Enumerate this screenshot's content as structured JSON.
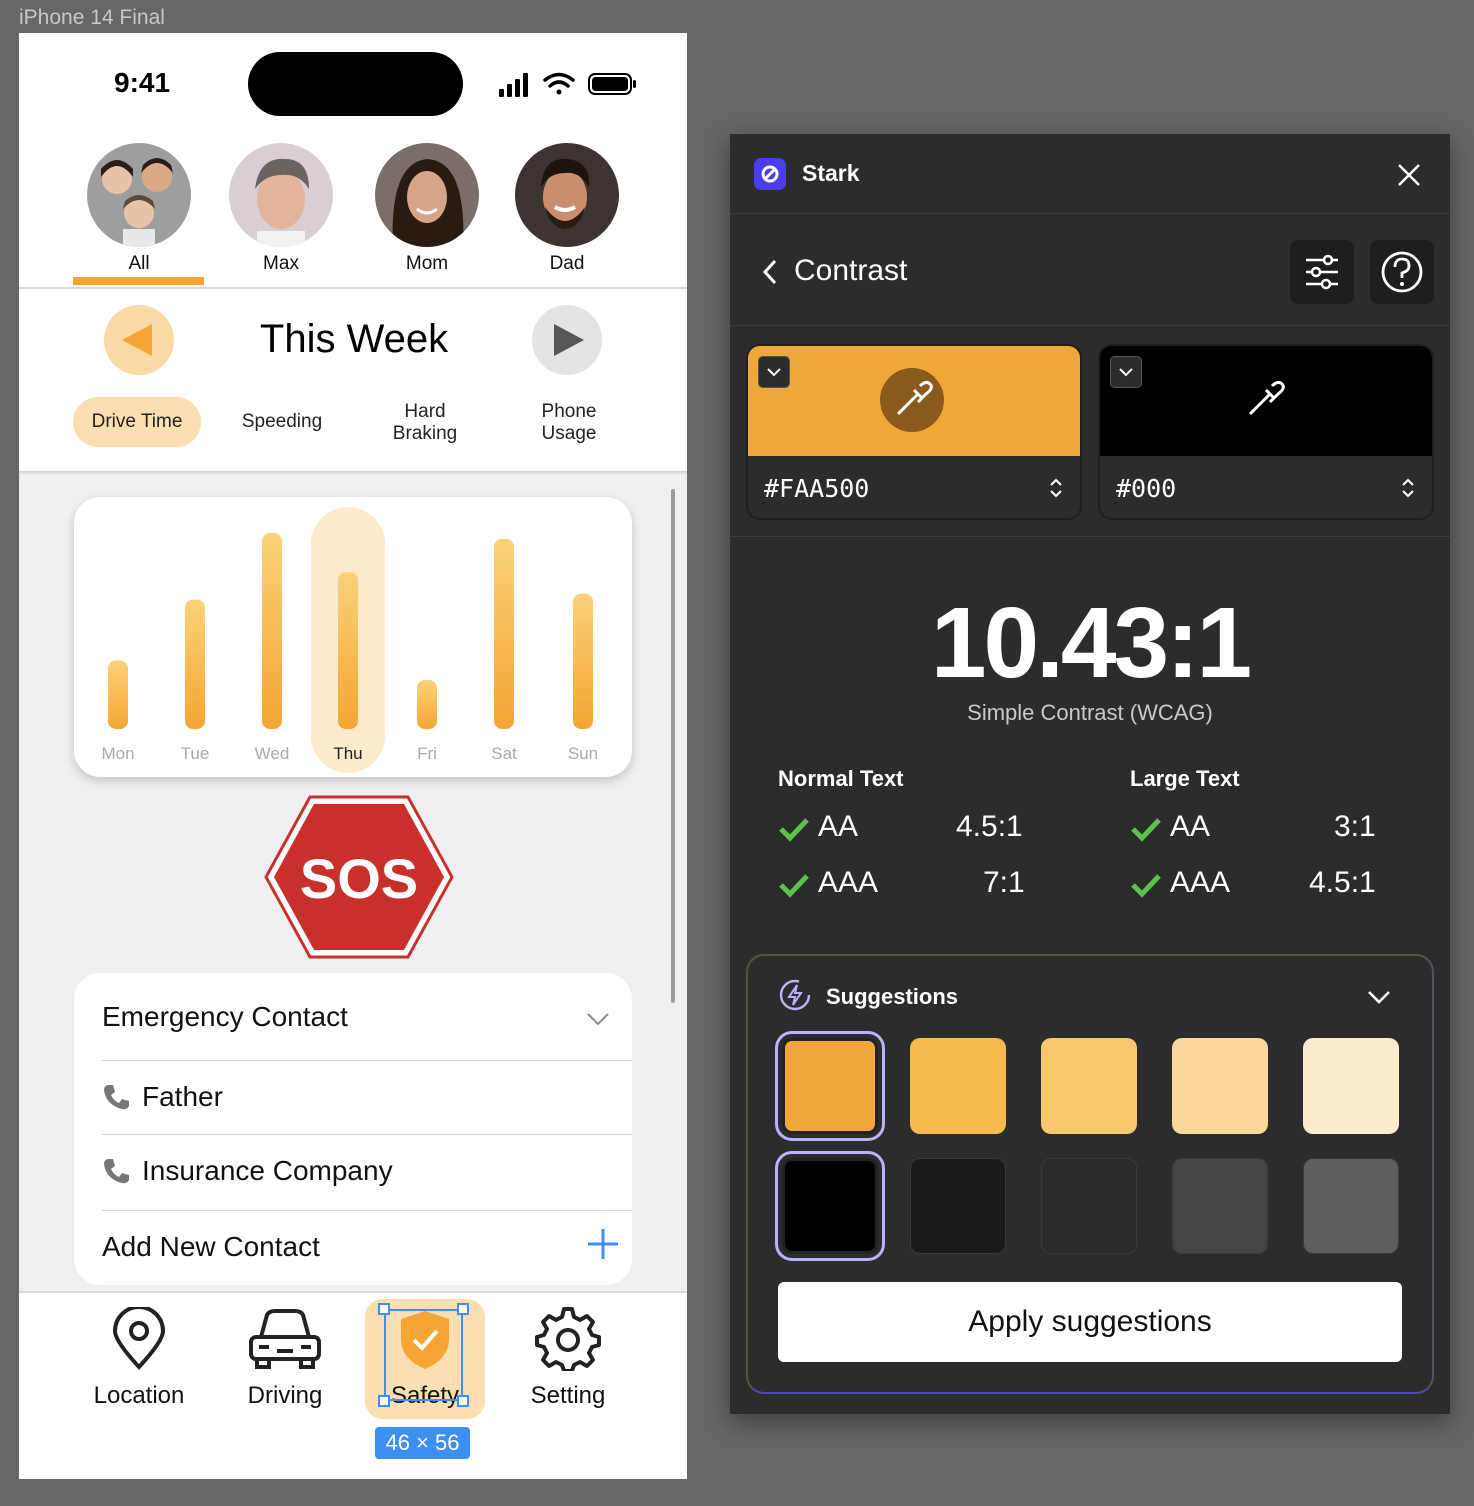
{
  "frame_label": "iPhone 14 Final",
  "phone": {
    "status_time": "9:41",
    "avatars": [
      {
        "label": "All",
        "selected": true
      },
      {
        "label": "Max",
        "selected": false
      },
      {
        "label": "Mom",
        "selected": false
      },
      {
        "label": "Dad",
        "selected": false
      }
    ],
    "week_title": "This Week",
    "metric_tabs": [
      {
        "label": "Drive Time",
        "active": true
      },
      {
        "label": "Speeding",
        "active": false
      },
      {
        "label": "Hard\nBraking",
        "active": false
      },
      {
        "label": "Phone\nUsage",
        "active": false
      }
    ],
    "chart_data": {
      "type": "bar",
      "categories": [
        "Mon",
        "Tue",
        "Wed",
        "Thu",
        "Fri",
        "Sat",
        "Sun"
      ],
      "values": [
        35,
        66,
        100,
        80,
        25,
        97,
        69
      ],
      "highlighted": "Thu",
      "ylim": [
        0,
        100
      ],
      "bar_color": "#f5a533"
    },
    "sos_label": "SOS",
    "contacts": {
      "header": "Emergency Contact",
      "items": [
        "Father",
        "Insurance Company"
      ],
      "add_label": "Add New Contact"
    },
    "tabbar": [
      {
        "label": "Location",
        "icon": "location-pin-icon"
      },
      {
        "label": "Driving",
        "icon": "car-icon"
      },
      {
        "label": "Safety",
        "icon": "shield-icon",
        "active": true
      },
      {
        "label": "Setting",
        "icon": "gear-icon"
      }
    ],
    "selection_dims": "46 × 56"
  },
  "stark": {
    "app_title": "Stark",
    "section_title": "Contrast",
    "foreground": {
      "hex": "#FAA500",
      "swatch": "#f0a73a"
    },
    "background": {
      "hex": "#000",
      "swatch": "#000000"
    },
    "ratio": "10.43:1",
    "ratio_label": "Simple Contrast (WCAG)",
    "normal_text": {
      "heading": "Normal Text",
      "rows": [
        {
          "level": "AA",
          "ratio": "4.5:1"
        },
        {
          "level": "AAA",
          "ratio": "7:1"
        }
      ]
    },
    "large_text": {
      "heading": "Large Text",
      "rows": [
        {
          "level": "AA",
          "ratio": "3:1"
        },
        {
          "level": "AAA",
          "ratio": "4.5:1"
        }
      ]
    },
    "suggestions": {
      "title": "Suggestions",
      "row1": [
        "#f0a73a",
        "#f6bb4f",
        "#f8c86f",
        "#fad89a",
        "#fcecce"
      ],
      "row2": [
        "#000000",
        "#1a1a1a",
        "#2b2b2b",
        "#444444",
        "#5e5e5e"
      ],
      "apply_label": "Apply suggestions"
    },
    "pass_color": "#5cc24a"
  }
}
